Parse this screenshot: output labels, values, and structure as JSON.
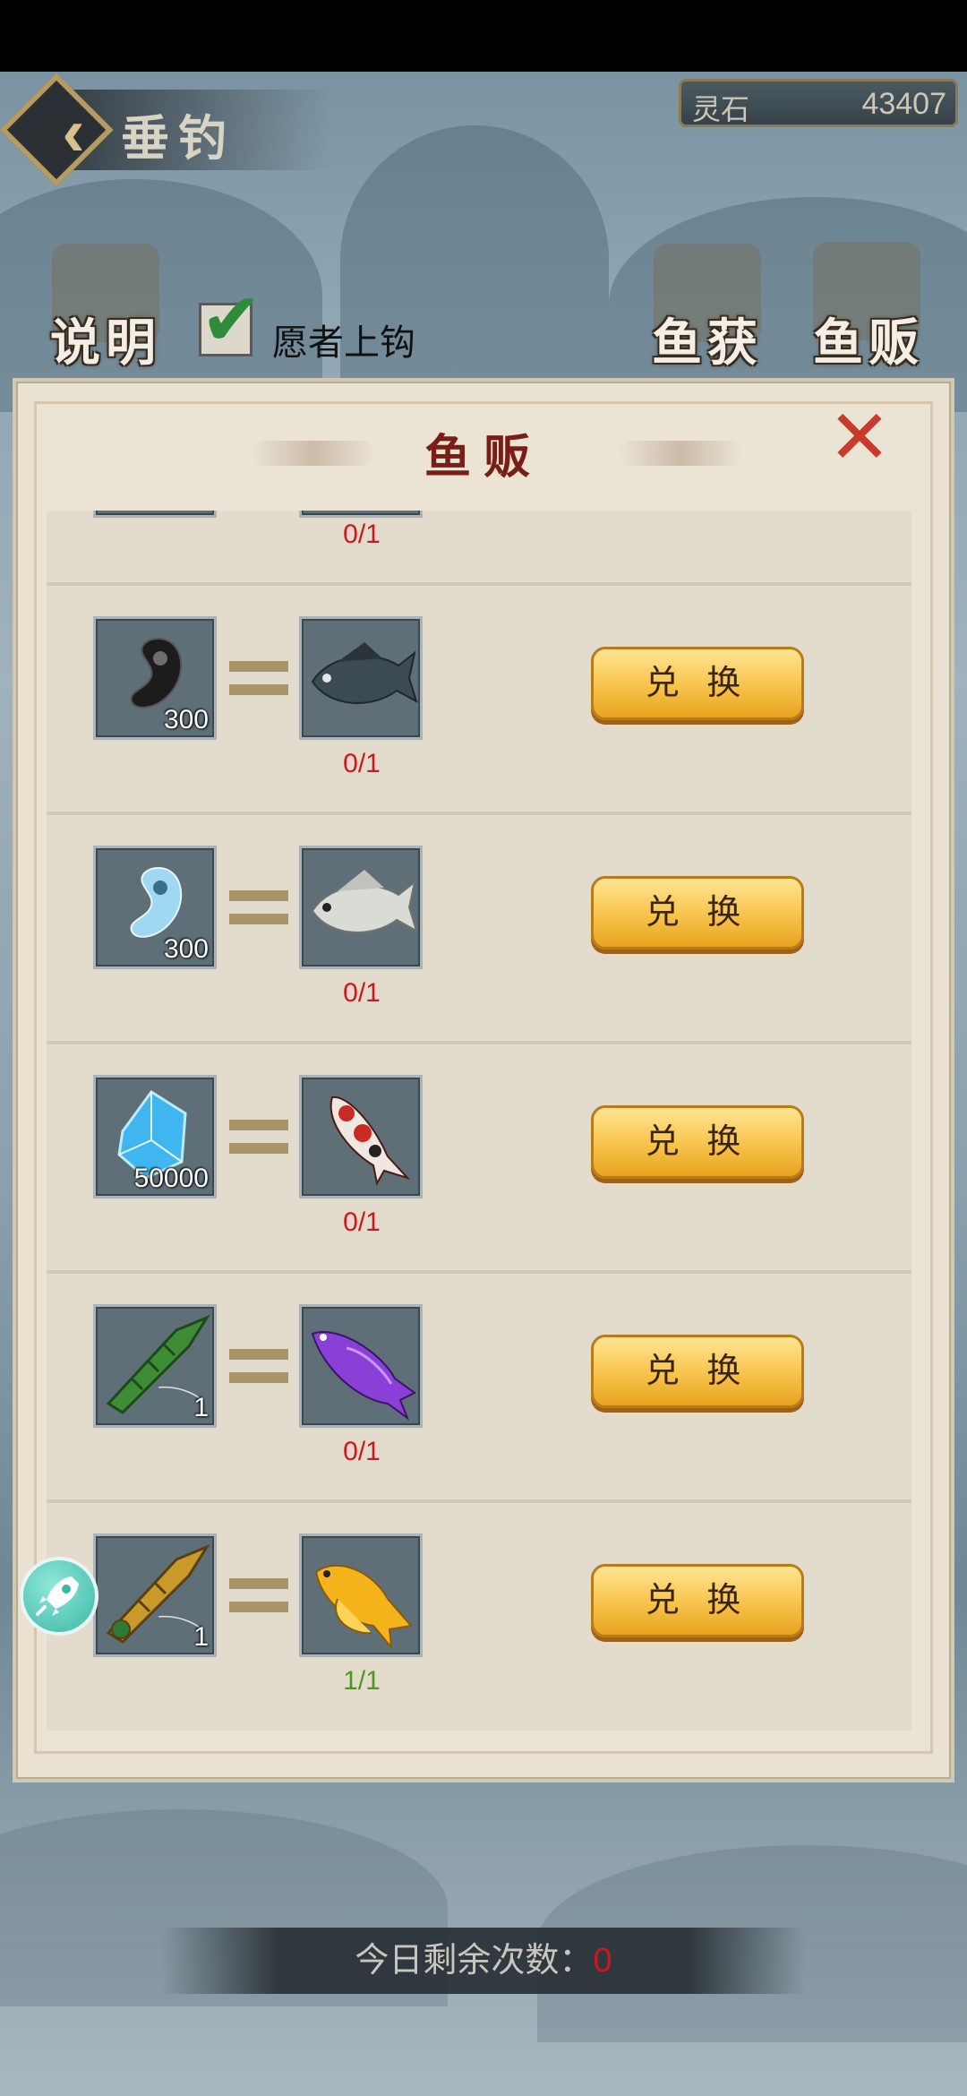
{
  "header": {
    "title": "垂钓",
    "currency_label": "灵石",
    "currency_value": "43407"
  },
  "toolbar": {
    "help_label": "说明",
    "willing_label": "愿者上钩",
    "willing_checked": true,
    "catch_label": "鱼获",
    "vendor_label": "鱼贩"
  },
  "panel": {
    "title": "鱼贩",
    "rows": [
      {
        "progress": "0/1"
      },
      {
        "cost_icon": "black-magatama-icon",
        "cost_count": "300",
        "reward_icon": "dark-bass-fish-icon",
        "progress": "0/1",
        "button_label": "兑 换"
      },
      {
        "cost_icon": "white-magatama-icon",
        "cost_count": "300",
        "reward_icon": "white-perch-fish-icon",
        "progress": "0/1",
        "button_label": "兑 换"
      },
      {
        "cost_icon": "blue-crystal-icon",
        "cost_count": "50000",
        "reward_icon": "koi-fish-icon",
        "progress": "0/1",
        "button_label": "兑 换"
      },
      {
        "cost_icon": "bamboo-fishing-rod-icon",
        "cost_count": "1",
        "reward_icon": "purple-arowana-fish-icon",
        "progress": "0/1",
        "button_label": "兑 换"
      },
      {
        "cost_icon": "golden-fishing-rod-icon",
        "cost_count": "1",
        "reward_icon": "golden-fish-icon",
        "progress": "1/1",
        "button_label": "兑 换"
      }
    ]
  },
  "footer": {
    "remaining_label": "今日剩余次数：",
    "remaining_count": "0"
  },
  "colors": {
    "progress_incomplete": "#d4151a",
    "progress_complete": "#4a9a1e",
    "panel_title": "#7a1d14",
    "exchange_button": "#f7c34a"
  }
}
